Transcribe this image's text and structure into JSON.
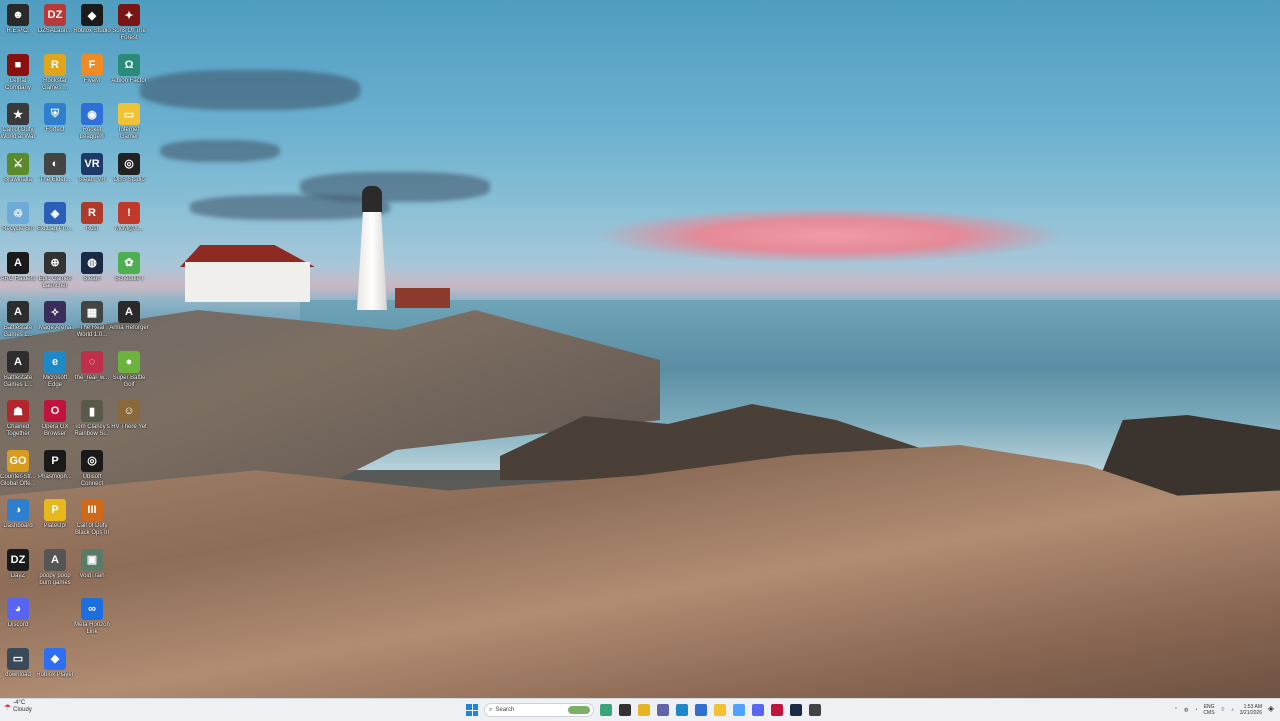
{
  "desktop": {
    "icons": [
      {
        "label": "R.E.P.O.",
        "color": "#2a2a2a",
        "glyph": "☻"
      },
      {
        "label": "DZSALaun...",
        "color": "#b63a3a",
        "glyph": "DZ"
      },
      {
        "label": "Roblox Studio",
        "color": "#1b1b1b",
        "glyph": "◆"
      },
      {
        "label": "Sons Of The Forest",
        "color": "#7a1515",
        "glyph": "✦"
      },
      {
        "label": "Lethal Company",
        "color": "#8a0f0f",
        "glyph": "■"
      },
      {
        "label": "Rockstar Games ...",
        "color": "#e0a51a",
        "glyph": "R"
      },
      {
        "label": "FiveM",
        "color": "#f08a24",
        "glyph": "F"
      },
      {
        "label": "Albion Factor",
        "color": "#2b8a7a",
        "glyph": "Ω"
      },
      {
        "label": "Call of Duty World at War",
        "color": "#3a3a3a",
        "glyph": "★"
      },
      {
        "label": "Fortect",
        "color": "#2f7fd0",
        "glyph": "⛨"
      },
      {
        "label": "Rocket League®",
        "color": "#2f6fd8",
        "glyph": "◉"
      },
      {
        "label": "Internet Gamer",
        "color": "#f1c232",
        "glyph": "▭"
      },
      {
        "label": "Brawlhalla",
        "color": "#5a8a2a",
        "glyph": "⚔"
      },
      {
        "label": "The Elder...",
        "color": "#444444",
        "glyph": "◐"
      },
      {
        "label": "Steam VR",
        "color": "#1d3a6b",
        "glyph": "VR"
      },
      {
        "label": "OBS Studio",
        "color": "#222222",
        "glyph": "◎"
      },
      {
        "label": "Recycle Bin",
        "color": "#6fa9d8",
        "glyph": "♲"
      },
      {
        "label": "ExitLag Pro...",
        "color": "#2a5fb8",
        "glyph": "◈"
      },
      {
        "label": "Rust",
        "color": "#b03b2a",
        "glyph": "R"
      },
      {
        "label": "McM@X...",
        "color": "#c0392b",
        "glyph": "!"
      },
      {
        "label": "ARC Raiders",
        "color": "#1a1a1a",
        "glyph": "A"
      },
      {
        "label": "Epic Games Launcher",
        "color": "#333333",
        "glyph": "⊕"
      },
      {
        "label": "Steam",
        "color": "#1b2a44",
        "glyph": "◍"
      },
      {
        "label": "Schedule I",
        "color": "#4caf50",
        "glyph": "✿"
      },
      {
        "label": "Battlestate Games L...",
        "color": "#2d2d2d",
        "glyph": "A"
      },
      {
        "label": "Mage Arena",
        "color": "#3b2d5a",
        "glyph": "✧"
      },
      {
        "label": "The Real World 1.0...",
        "color": "#444444",
        "glyph": "▦"
      },
      {
        "label": "Arma Reforger",
        "color": "#2a2a2a",
        "glyph": "A"
      },
      {
        "label": "Battlestate Games L...",
        "color": "#2d2d2d",
        "glyph": "A"
      },
      {
        "label": "Microsoft Edge",
        "color": "#1e88c8",
        "glyph": "e"
      },
      {
        "label": "the_real_w...",
        "color": "#c0304a",
        "glyph": "◌"
      },
      {
        "label": "Super Battle Golf",
        "color": "#6cb33e",
        "glyph": "●"
      },
      {
        "label": "Chained Together",
        "color": "#b3262b",
        "glyph": "☗"
      },
      {
        "label": "Opera GX Browser",
        "color": "#c0143c",
        "glyph": "O"
      },
      {
        "label": "Tom Clancy's Rainbow Si...",
        "color": "#5a5a4a",
        "glyph": "▮"
      },
      {
        "label": "RV There Yet",
        "color": "#8a6a3a",
        "glyph": "☺"
      },
      {
        "label": "Counter-Str... Global Offe...",
        "color": "#d79b20",
        "glyph": "GO"
      },
      {
        "label": "Phasmoph...",
        "color": "#1a1a1a",
        "glyph": "P"
      },
      {
        "label": "Ubisoft Connect",
        "color": "#1a1a1a",
        "glyph": "◎"
      },
      {
        "label": "Dashboard",
        "color": "#2f7fd0",
        "glyph": "◑"
      },
      {
        "label": "PlateUp!",
        "color": "#e6b81e",
        "glyph": "P"
      },
      {
        "label": "Call of Duty Black Ops III",
        "color": "#d06a1a",
        "glyph": "III"
      },
      {
        "label": "DayZ",
        "color": "#1a1a1a",
        "glyph": "DZ"
      },
      {
        "label": "poopy poop bum games",
        "color": "#555555",
        "glyph": "A"
      },
      {
        "label": "VoidTrain",
        "color": "#5a7a6a",
        "glyph": "▣"
      },
      {
        "label": "Discord",
        "color": "#5865f2",
        "glyph": "◕"
      },
      {
        "label": "Meta Horizon Link",
        "color": "#1d6fe0",
        "glyph": "∞"
      },
      {
        "label": "download",
        "color": "#3a4a5a",
        "glyph": "▭"
      },
      {
        "label": "Roblox Player",
        "color": "#2d6ff2",
        "glyph": "◆"
      }
    ]
  },
  "taskbar": {
    "weather_temp": "-4°C",
    "weather_desc": "Cloudy",
    "search_placeholder": "Search",
    "pinned_icons": [
      "copilot-icon",
      "taskview-icon",
      "file-explorer-icon",
      "teams-icon",
      "edge-icon",
      "store-icon",
      "explorer-folder-icon",
      "photos-icon",
      "discord-icon",
      "opera-gx-icon",
      "steam-icon",
      "epic-icon"
    ],
    "lang_line1": "ENG",
    "lang_line2": "CMS",
    "time": "1:53 AM",
    "date": "3/21/2026"
  }
}
